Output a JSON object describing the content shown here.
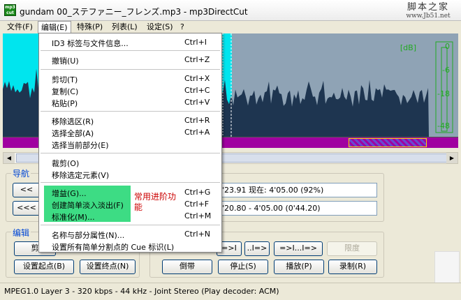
{
  "window": {
    "title": "gundam 00_ステファニー_フレンズ.mp3 - mp3DirectCut",
    "app_icon_text": "mp3\ncut"
  },
  "watermark": {
    "line1": "脚本之家",
    "line2": "www.Jb51.net"
  },
  "menubar": [
    {
      "label": "文件(F)",
      "active": false
    },
    {
      "label": "编辑(E)",
      "active": true
    },
    {
      "label": "特殊(P)",
      "active": false
    },
    {
      "label": "列表(L)",
      "active": false
    },
    {
      "label": "设定(S)",
      "active": false
    },
    {
      "label": "?",
      "active": false
    }
  ],
  "waveform": {
    "db_label": "[dB]",
    "db_scale": [
      "0",
      "-6",
      "-18",
      "-48"
    ],
    "colors": {
      "background": "#8fa3b5",
      "wave": "#1e3550",
      "selection": "#00e5ee",
      "meter": "#22aa22"
    }
  },
  "nav": {
    "title": "导航",
    "btn_back": "<<",
    "btn_back2": "<<<",
    "time_info": "4'23.91  现在: 4'05.00  (92%)",
    "sel_info": "4'20.80 - 4'05.00 (0'44.20)"
  },
  "edit_group": {
    "title": "编辑",
    "btn_cut_partial": "剪",
    "btn_set_start": "设置起点(B)",
    "btn_set_end": "设置终点(N)"
  },
  "transport": {
    "btn_goto_end": "=>I",
    "btn_next_cue": "..I=>",
    "btn_play_sel": "=>I...I=>",
    "limit_label": "限度",
    "btn_rewind": "倒带",
    "btn_stop": "停止(S)",
    "btn_play": "播放(P)",
    "btn_record": "录制(R)"
  },
  "edit_menu": {
    "items": [
      {
        "label": "ID3 标签与文件信息...",
        "shortcut": "Ctrl+I"
      },
      {
        "label": "撤销(U)",
        "shortcut": "Ctrl+Z"
      },
      {
        "label": "剪切(T)",
        "shortcut": "Ctrl+X"
      },
      {
        "label": "复制(C)",
        "shortcut": "Ctrl+C"
      },
      {
        "label": "粘贴(P)",
        "shortcut": "Ctrl+V"
      },
      {
        "label": "移除选区(R)",
        "shortcut": "Ctrl+R"
      },
      {
        "label": "选择全部(A)",
        "shortcut": "Ctrl+A"
      },
      {
        "label": "选择当前部分(E)",
        "shortcut": ""
      },
      {
        "label": "裁剪(O)",
        "shortcut": ""
      },
      {
        "label": "移除选定元素(V)",
        "shortcut": ""
      },
      {
        "label": "增益(G)...",
        "shortcut": "Ctrl+G"
      },
      {
        "label": "创建简单淡入淡出(F)",
        "shortcut": "Ctrl+F"
      },
      {
        "label": "标准化(M)...",
        "shortcut": "Ctrl+M"
      },
      {
        "label": "名称与部分属性(N)...",
        "shortcut": "Ctrl+N"
      },
      {
        "label": "设置所有简单分割点的 Cue 标识(L)",
        "shortcut": ""
      }
    ],
    "annotation": "常用进阶功能"
  },
  "status": {
    "text": "MPEG1.0 Layer 3 - 320 kbps - 44 kHz - Joint Stereo   (Play decoder: ACM)"
  }
}
